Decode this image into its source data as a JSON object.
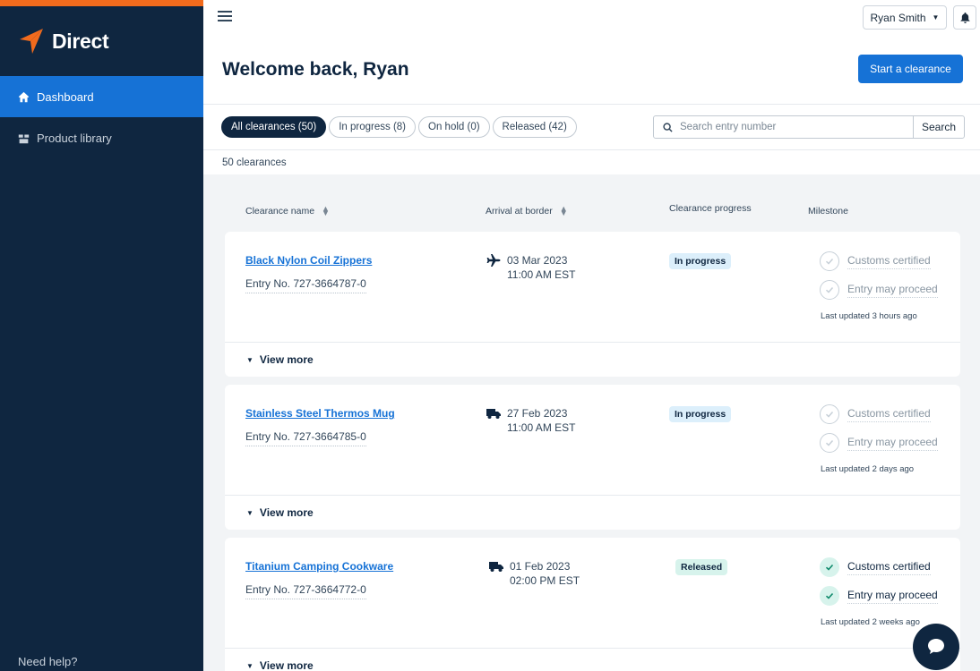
{
  "brand": {
    "name": "Direct",
    "accent": "#f26b1d"
  },
  "sidebar": {
    "items": [
      {
        "label": "Dashboard",
        "icon": "home-icon",
        "active": true
      },
      {
        "label": "Product library",
        "icon": "boxes-icon",
        "active": false
      }
    ],
    "help": "Need help?"
  },
  "header": {
    "user_name": "Ryan Smith",
    "title": "Welcome back, Ryan",
    "cta": "Start a clearance"
  },
  "filters": [
    {
      "label": "All clearances (50)",
      "active": true
    },
    {
      "label": "In progress (8)",
      "active": false
    },
    {
      "label": "On hold (0)",
      "active": false
    },
    {
      "label": "Released (42)",
      "active": false
    }
  ],
  "search": {
    "placeholder": "Search entry number",
    "value": "",
    "button": "Search"
  },
  "count_label": "50 clearances",
  "columns": {
    "name": "Clearance name",
    "arrival": "Arrival at border",
    "progress": "Clearance progress",
    "milestone": "Milestone"
  },
  "clearances": [
    {
      "name": "Black Nylon Coil Zippers",
      "entry": "Entry No. 727-3664787-0",
      "mode": "plane",
      "date": "03 Mar 2023",
      "time": "11:00 AM EST",
      "status": "In progress",
      "milestones": [
        {
          "label": "Customs certified",
          "done": false
        },
        {
          "label": "Entry may proceed",
          "done": false
        }
      ],
      "updated": "Last updated 3 hours ago",
      "view_more": "View more"
    },
    {
      "name": "Stainless Steel Thermos Mug",
      "entry": "Entry No. 727-3664785-0",
      "mode": "truck",
      "date": "27 Feb 2023",
      "time": "11:00 AM EST",
      "status": "In progress",
      "milestones": [
        {
          "label": "Customs certified",
          "done": false
        },
        {
          "label": "Entry may proceed",
          "done": false
        }
      ],
      "updated": "Last updated 2 days ago",
      "view_more": "View more"
    },
    {
      "name": "Titanium Camping Cookware",
      "entry": "Entry No. 727-3664772-0",
      "mode": "truck",
      "date": "01 Feb 2023",
      "time": "02:00 PM EST",
      "status": "Released",
      "milestones": [
        {
          "label": "Customs certified",
          "done": true
        },
        {
          "label": "Entry may proceed",
          "done": true
        }
      ],
      "updated": "Last updated 2 weeks ago",
      "view_more": "View more"
    }
  ]
}
